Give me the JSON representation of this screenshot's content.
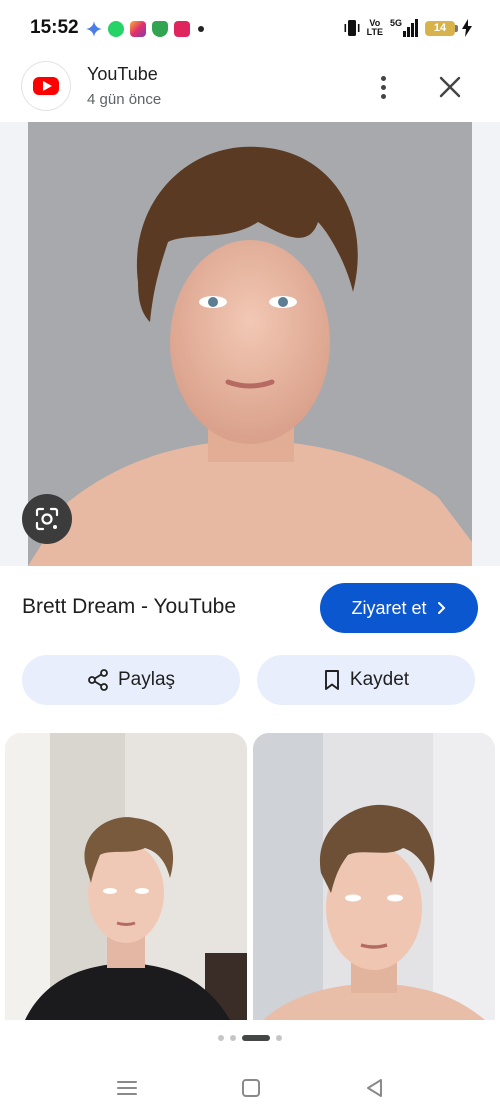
{
  "status_bar": {
    "time": "15:52",
    "network_volte_top": "Vo",
    "network_volte_bottom": "LTE",
    "network_type": "5G",
    "battery": "14"
  },
  "header": {
    "source_name": "YouTube",
    "posted_age": "4 gün önce"
  },
  "result": {
    "title": "Brett Dream - YouTube",
    "visit_label": "Ziyaret et",
    "share_label": "Paylaş",
    "save_label": "Kaydet"
  },
  "pager": {
    "total": 5,
    "current": 3
  },
  "colors": {
    "accent": "#0b57d0",
    "pill_bg": "#e8eefb",
    "youtube_red": "#ff0000"
  },
  "icons": [
    "youtube-logo",
    "more-vert-icon",
    "close-icon",
    "google-lens-icon",
    "share-icon",
    "bookmark-icon",
    "chevron-right-icon",
    "recents-icon",
    "home-icon",
    "back-icon"
  ]
}
